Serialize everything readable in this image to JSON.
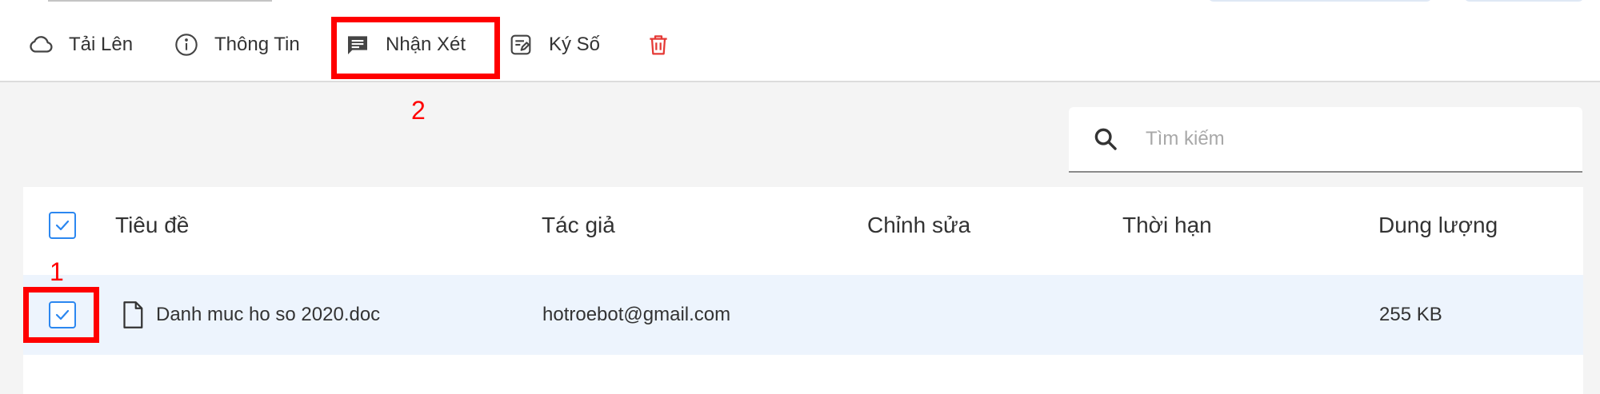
{
  "toolbar": {
    "upload_label": "Tải Lên",
    "info_label": "Thông Tin",
    "comment_label": "Nhận Xét",
    "sign_label": "Ký Số",
    "upload_icon": "cloud-icon",
    "info_icon": "info-icon",
    "comment_icon": "comment-icon",
    "sign_icon": "sign-document-icon",
    "delete_icon": "trash-icon"
  },
  "annotations": [
    {
      "number": "1",
      "color": "#ff0000"
    },
    {
      "number": "2",
      "color": "#ff0000"
    }
  ],
  "search": {
    "placeholder": "Tìm kiếm",
    "icon": "search-icon"
  },
  "table": {
    "columns": [
      "Tiêu đề",
      "Tác giả",
      "Chỉnh sửa",
      "Thời hạn",
      "Dung lượng"
    ],
    "select_all_checked": true,
    "rows": [
      {
        "checked": true,
        "title": "Danh muc ho so 2020.doc",
        "author": "hotroebot@gmail.com",
        "edited": "",
        "deadline": "",
        "size": "255 KB"
      }
    ]
  },
  "colors": {
    "accent": "#2b87f0",
    "highlight": "#ff0000",
    "delete": "#e53935",
    "selected_row": "#edf4fd"
  }
}
